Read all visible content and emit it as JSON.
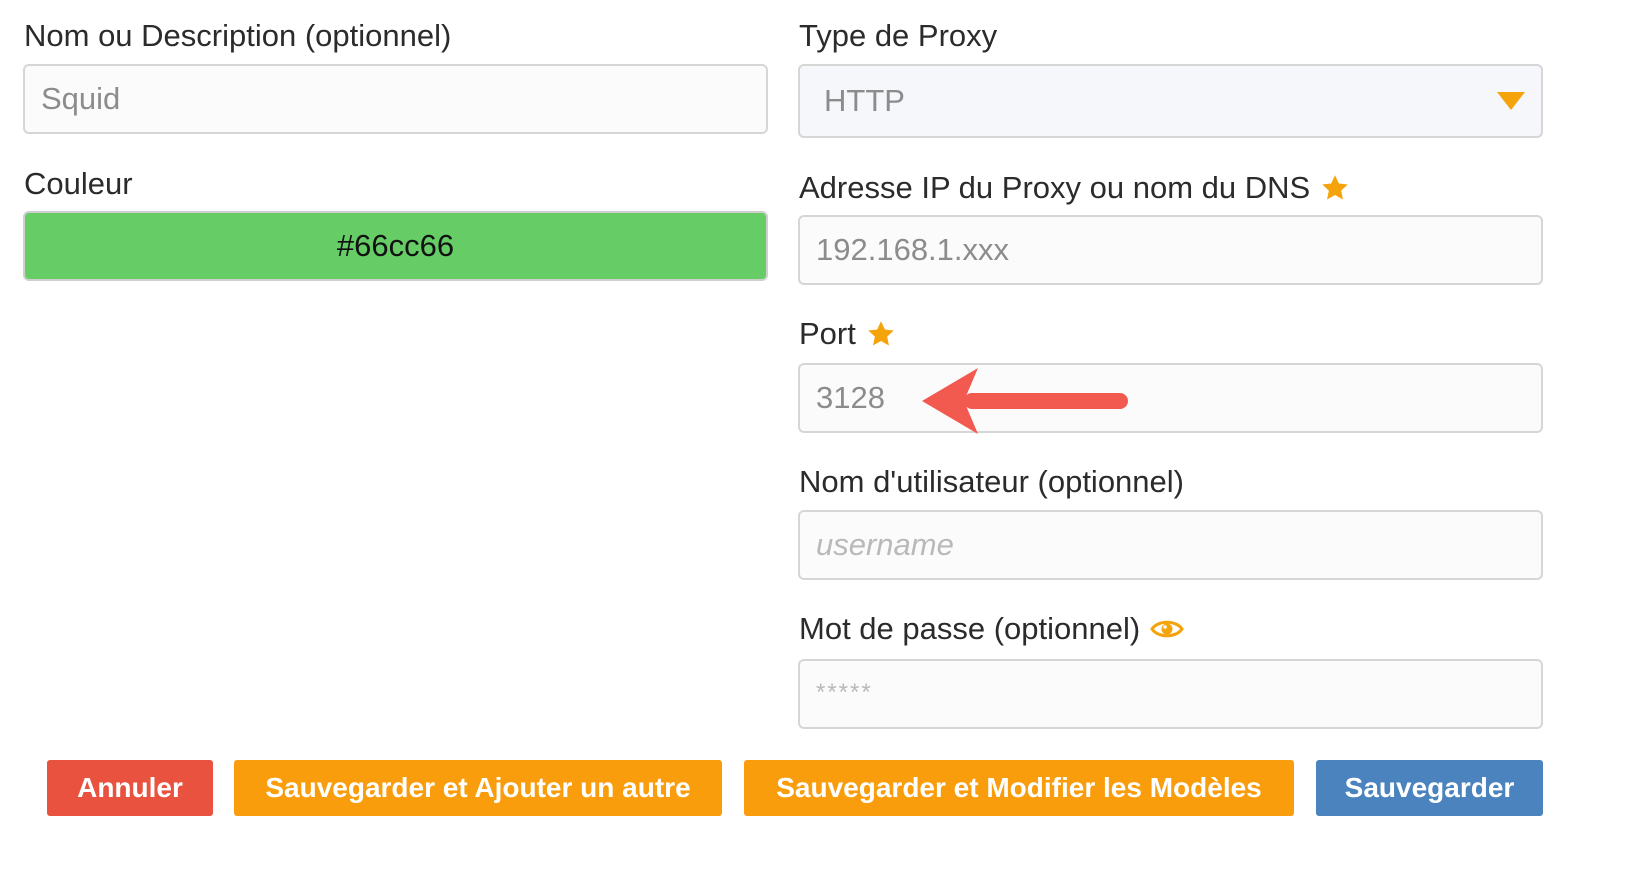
{
  "name_field": {
    "label": "Nom ou Description (optionnel)",
    "value": "Squid"
  },
  "color_field": {
    "label": "Couleur",
    "value": "#66cc66",
    "swatch_color": "#66cc66"
  },
  "proxy_type": {
    "label": "Type de Proxy",
    "selected": "HTTP"
  },
  "proxy_address": {
    "label": "Adresse IP du Proxy ou nom du DNS",
    "required_icon": "star-icon",
    "value": "192.168.1.xxx"
  },
  "port": {
    "label": "Port",
    "required_icon": "star-icon",
    "value": "3128"
  },
  "username": {
    "label": "Nom d'utilisateur (optionnel)",
    "placeholder": "username"
  },
  "password": {
    "label": "Mot de passe (optionnel)",
    "toggle_icon": "eye-icon",
    "placeholder": "*****"
  },
  "buttons": {
    "cancel": "Annuler",
    "save_add": "Sauvegarder et Ajouter un autre",
    "save_edit_patterns": "Sauvegarder et Modifier les Modèles",
    "save": "Sauvegarder"
  },
  "colors": {
    "accent": "#fa9d0d",
    "danger": "#e9523f",
    "primary": "#4a83bd",
    "arrow": "#f25a4f"
  }
}
